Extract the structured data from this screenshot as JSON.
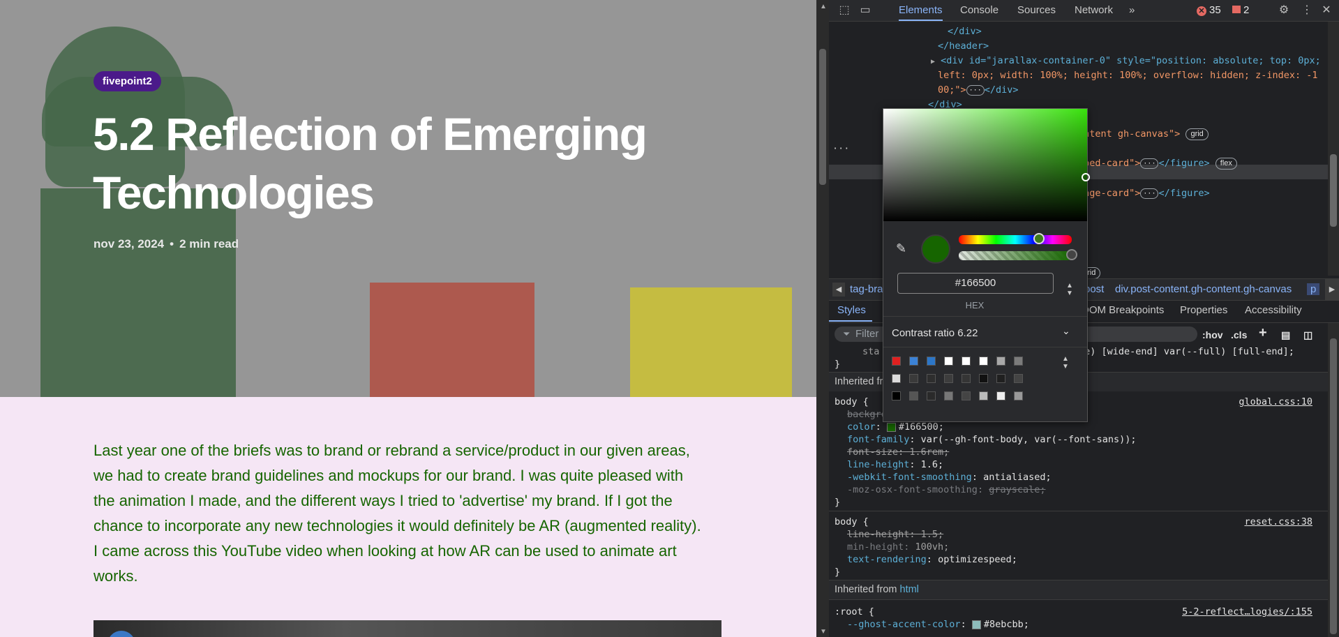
{
  "page": {
    "tag": "fivepoint2",
    "title": "5.2 Reflection of Emerging Technologies",
    "date": "nov 23, 2024",
    "separator": "•",
    "read_time": "2 min read",
    "body": "Last year one of the briefs was to brand or rebrand a service/product in our given areas, we had to create brand guidelines and mockups for our brand. I was quite pleased with the animation I made, and the different ways I tried to 'advertise' my brand. If I got the chance to incorporate any new technologies it would definitely be AR (augmented reality). I came across this YouTube video when looking at how AR can be used to animate art works.",
    "text_color": "#166500"
  },
  "devtools": {
    "tabs": [
      "Elements",
      "Console",
      "Sources",
      "Network"
    ],
    "more_tabs": "»",
    "errors": "35",
    "warnings": "2",
    "dom": {
      "close_div": "</div>",
      "close_header": "</header>",
      "jarallax_open": "<div id=\"jarallax-container-0\" style=\"position: absolute; top: 0px;",
      "jarallax_line2": "left: 0px; width: 100%; height: 100%; overflow: hidden; z-index: -1",
      "jarallax_line3": "00;\">",
      "close_div_2": "</div>",
      "content_canvas": "ontent gh-canvas\">",
      "embed_card": "mbed-card\">",
      "image_card": "mage-card\">",
      "close_figure": "</figure>",
      "pill_grid": "grid",
      "pill_flex": "flex",
      "dots": "···"
    },
    "breadcrumb": [
      "tag-bra",
      "post",
      "div.post-content.gh-content.gh-canvas",
      "p"
    ],
    "pane_tabs": [
      "Styles",
      "DOM Breakpoints",
      "Properties",
      "Accessibility"
    ],
    "filter_placeholder": "Filter",
    "filter_tools": [
      ":hov",
      ".cls",
      "+"
    ],
    "styles": {
      "grid_line": "sta",
      "grid_line_tail": "de) [wide-end] var(--full) [full-end];",
      "inherited_from_label": "Inherited fr",
      "rule1_selector": "body {",
      "rule1_source": "global.css:10",
      "rule1_bg": "background-color: var(--color-white);",
      "rule1_color_prop": "color",
      "rule1_color_val": "#166500;",
      "rule1_font_family_prop": "font-family",
      "rule1_font_family_val": "var(--gh-font-body, var(--font-sans));",
      "rule1_font_size": "font-size: 1.6rem;",
      "rule1_line_height_prop": "line-height",
      "rule1_line_height_val": "1.6;",
      "rule1_smoothing_prop": "-webkit-font-smoothing",
      "rule1_smoothing_val": "antialiased;",
      "rule1_moz_prop": "-moz-osx-font-smoothing",
      "rule1_moz_val": "grayscale;",
      "close": "}",
      "rule2_selector": "body {",
      "rule2_source": "reset.css:38",
      "rule2_line_height": "line-height: 1.5;",
      "rule2_min_height_prop": "min-height",
      "rule2_min_height_val": "100vh;",
      "rule2_text_rendering_prop": "text-rendering",
      "rule2_text_rendering_val": "optimizespeed;",
      "inherited_html_label": "Inherited from",
      "inherited_html_link": "html",
      "root_selector": ":root {",
      "root_source": "5-2-reflect…logies/:155",
      "root_prop": "--ghost-accent-color",
      "root_val": "#8ebcbb;",
      "accent_swatch": "#8ebcbb"
    },
    "color_picker": {
      "hex_value": "#166500",
      "format_label": "HEX",
      "contrast_label": "Contrast ratio",
      "contrast_value": "6.22",
      "palette": [
        [
          "#e02020",
          "#3b82d6",
          "#2c76c7",
          "#ffffff",
          "#ffffff",
          "#ffffff",
          "#a8a8a8",
          "#7b7b7b"
        ],
        [
          "#dcdcdc",
          "#3a3a3a",
          "#2e2e2e",
          "#3d3d3d",
          "#353535",
          "#111111",
          "#202020",
          "#444444"
        ],
        [
          "#000000",
          "#555555",
          "#2a2a2a",
          "#777777",
          "#444444",
          "#bbbbbb",
          "#eeeeee",
          "#999999"
        ]
      ]
    }
  }
}
